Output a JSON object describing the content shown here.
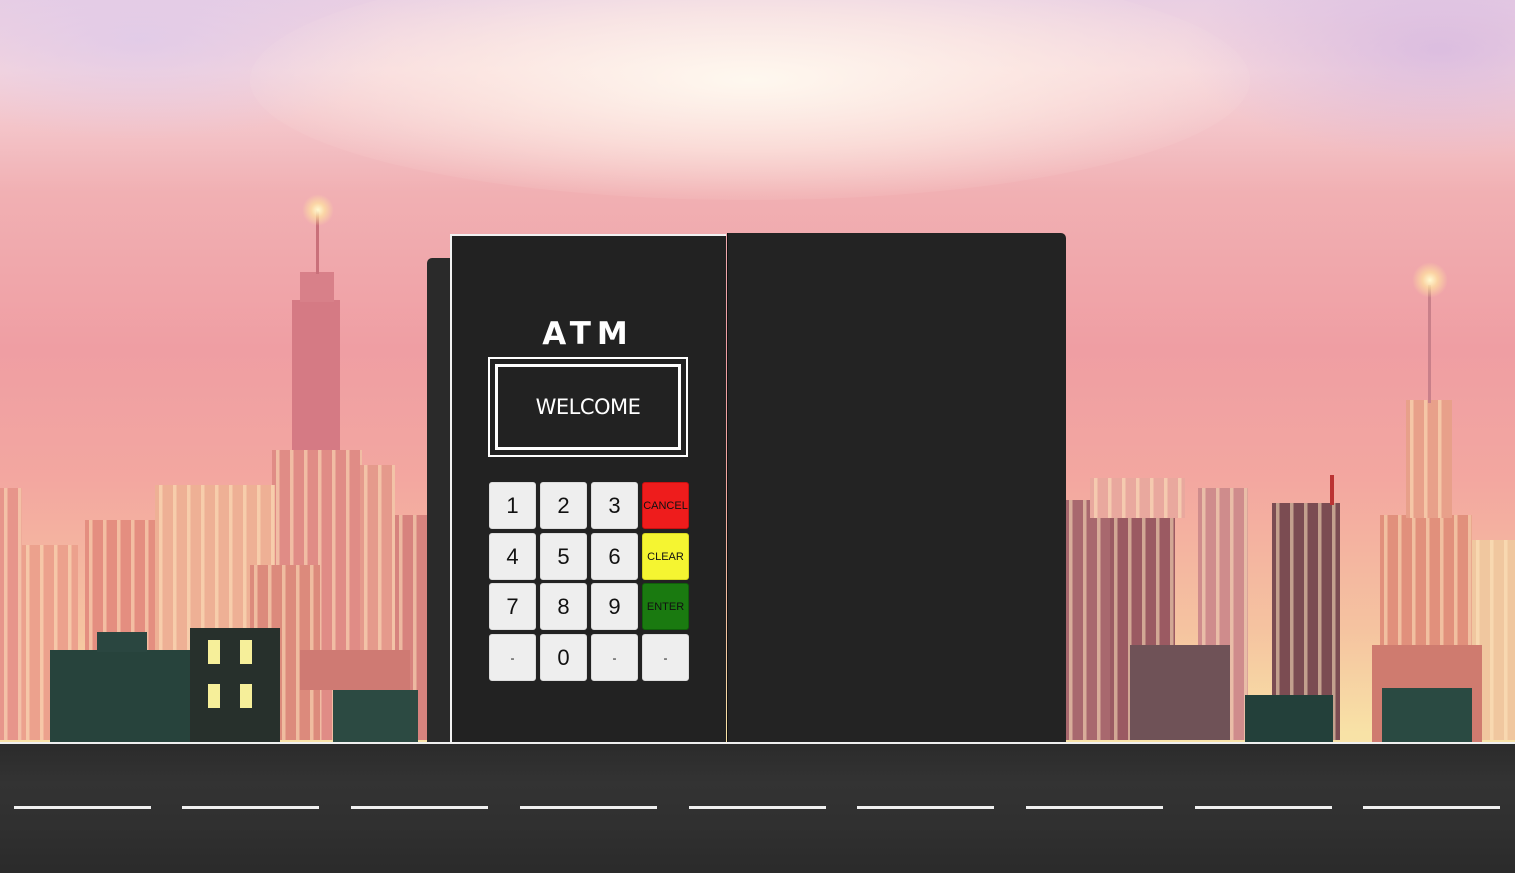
{
  "atm": {
    "title": "ATM",
    "screen_message": "WELCOME",
    "keys": {
      "k1": "1",
      "k2": "2",
      "k3": "3",
      "k4": "4",
      "k5": "5",
      "k6": "6",
      "k7": "7",
      "k8": "8",
      "k9": "9",
      "k0": "0",
      "blank1": "-",
      "blank2": "-",
      "blank3": "-",
      "cancel": "CANCEL",
      "clear": "CLEAR",
      "enter": "ENTER"
    }
  },
  "colors": {
    "cancel": "#ee1c1c",
    "clear": "#f5f531",
    "enter": "#1a7a10",
    "atm_body": "#222222"
  }
}
